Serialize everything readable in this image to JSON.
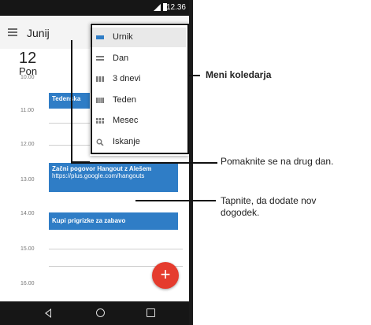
{
  "status": {
    "time": "12.36"
  },
  "appbar": {
    "month": "Junij"
  },
  "day": {
    "number": "12",
    "name": "Pon"
  },
  "hours": [
    "10.00",
    "11.00",
    "12.00",
    "13.00",
    "14.00",
    "15.00",
    "16.00"
  ],
  "events": [
    {
      "title": "Tedenska"
    },
    {
      "title": "Začni pogovor Hangout z Alešem",
      "subtitle": "https://plus.google.com/hangouts"
    },
    {
      "title": "Kupi prigrizke za zabavo"
    }
  ],
  "fab": {
    "label": "+"
  },
  "menu": {
    "items": [
      {
        "label": "Urnik",
        "icon": "schedule-icon"
      },
      {
        "label": "Dan",
        "icon": "day-icon"
      },
      {
        "label": "3 dnevi",
        "icon": "three-day-icon"
      },
      {
        "label": "Teden",
        "icon": "week-icon"
      },
      {
        "label": "Mesec",
        "icon": "month-icon"
      },
      {
        "label": "Iskanje",
        "icon": "search-icon"
      }
    ]
  },
  "callouts": {
    "menu": "Meni koledarja",
    "swipe": "Pomaknite se na drug dan.",
    "tap_line1": "Tapnite, da dodate nov",
    "tap_line2": "dogodek."
  },
  "colors": {
    "accent": "#2f7dc6",
    "fab": "#e53c2e",
    "statusbar": "#161616"
  }
}
